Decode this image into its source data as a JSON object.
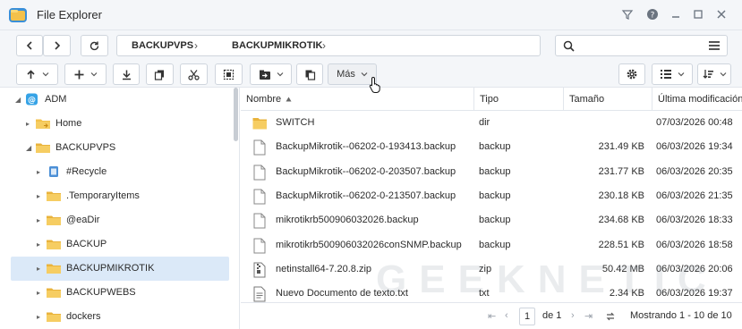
{
  "window": {
    "title": "File Explorer",
    "icon": "file-explorer-app-icon",
    "controls": [
      "filter-icon",
      "help-icon",
      "minimize-icon",
      "maximize-icon",
      "close-icon"
    ]
  },
  "nav": {
    "back_icon": "chevron-left-icon",
    "forward_icon": "chevron-right-icon",
    "refresh_icon": "refresh-icon",
    "breadcrumb": [
      "BACKUPVPS",
      "BACKUPMIKROTIK"
    ],
    "search_value": "",
    "search_icon": "search-icon",
    "search_options_icon": "list-options-icon"
  },
  "toolbar": {
    "upload_icon": "upload-icon",
    "create_icon": "plus-icon",
    "download_icon": "download-icon",
    "copy_icon": "copy-icon",
    "cut_icon": "scissors-icon",
    "select_icon": "select-all-icon",
    "copy_to_icon": "copy-to-icon",
    "duplicate_icon": "duplicate-icon",
    "more_label": "Más",
    "settings_icon": "gear-icon",
    "view_icon": "list-view-icon",
    "sort_icon": "sort-icon"
  },
  "tree": {
    "items": [
      {
        "label": "ADM",
        "icon": "adm-drive-icon",
        "level": 0,
        "expanded": true
      },
      {
        "label": "Home",
        "icon": "home-folder-icon",
        "level": 1,
        "expanded": false
      },
      {
        "label": "BACKUPVPS",
        "icon": "folder-icon",
        "level": 1,
        "expanded": true
      },
      {
        "label": "#Recycle",
        "icon": "recycle-bin-icon",
        "level": 2,
        "expanded": false
      },
      {
        "label": ".TemporaryItems",
        "icon": "folder-icon",
        "level": 2,
        "expanded": false
      },
      {
        "label": "@eaDir",
        "icon": "folder-icon",
        "level": 2,
        "expanded": false
      },
      {
        "label": "BACKUP",
        "icon": "folder-icon",
        "level": 2,
        "expanded": false
      },
      {
        "label": "BACKUPMIKROTIK",
        "icon": "folder-icon",
        "level": 2,
        "expanded": false,
        "selected": true
      },
      {
        "label": "BACKUPWEBS",
        "icon": "folder-icon",
        "level": 2,
        "expanded": false
      },
      {
        "label": "dockers",
        "icon": "folder-icon",
        "level": 2,
        "expanded": false
      }
    ]
  },
  "table": {
    "columns": [
      "Nombre",
      "Tipo",
      "Tamaño",
      "Última modificación"
    ],
    "sort_column": "Nombre",
    "sort_direction": "asc",
    "rows": [
      {
        "name": "SWITCH",
        "type": "dir",
        "size": "",
        "modified": "07/03/2026 00:48",
        "icon": "folder-icon"
      },
      {
        "name": "BackupMikrotik--06202-0-193413.backup",
        "type": "backup",
        "size": "231.49 KB",
        "modified": "06/03/2026 19:34",
        "icon": "file-icon"
      },
      {
        "name": "BackupMikrotik--06202-0-203507.backup",
        "type": "backup",
        "size": "231.77 KB",
        "modified": "06/03/2026 20:35",
        "icon": "file-icon"
      },
      {
        "name": "BackupMikrotik--06202-0-213507.backup",
        "type": "backup",
        "size": "230.18 KB",
        "modified": "06/03/2026 21:35",
        "icon": "file-icon"
      },
      {
        "name": "mikrotikrb500906032026.backup",
        "type": "backup",
        "size": "234.68 KB",
        "modified": "06/03/2026 18:33",
        "icon": "file-icon"
      },
      {
        "name": "mikrotikrb500906032026conSNMP.backup",
        "type": "backup",
        "size": "228.51 KB",
        "modified": "06/03/2026 18:58",
        "icon": "file-icon"
      },
      {
        "name": "netinstall64-7.20.8.zip",
        "type": "zip",
        "size": "50.42 MB",
        "modified": "06/03/2026 20:06",
        "icon": "zip-file-icon"
      },
      {
        "name": "Nuevo Documento de texto.txt",
        "type": "txt",
        "size": "2.34 KB",
        "modified": "06/03/2026 19:37",
        "icon": "text-file-icon"
      }
    ]
  },
  "pagination": {
    "page": "1",
    "of_label": "de 1",
    "status": "Mostrando 1 - 10 de 10"
  },
  "watermark": "GEEKNETIC",
  "colors": {
    "chrome_bg": "#f4f6f9",
    "selection": "#dbe9f8",
    "folder": "#f3c14b",
    "border": "#cfd5dd"
  }
}
